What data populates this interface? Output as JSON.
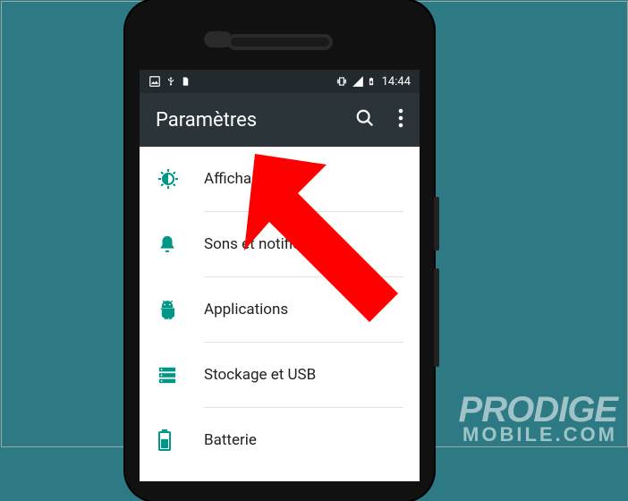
{
  "status_bar": {
    "clock": "14:44"
  },
  "app_bar": {
    "title": "Paramètres"
  },
  "settings": {
    "items": [
      {
        "label": "Affichage"
      },
      {
        "label": "Sons et notifications"
      },
      {
        "label": "Applications"
      },
      {
        "label": "Stockage et USB"
      },
      {
        "label": "Batterie"
      }
    ]
  },
  "watermark": {
    "line1": "PRODIGE",
    "line2": "MOBILE.COM"
  },
  "colors": {
    "accent": "#009688",
    "app_bar_bg": "#2b3539",
    "status_bar_bg": "#232a2d",
    "arrow": "#ff0000"
  }
}
